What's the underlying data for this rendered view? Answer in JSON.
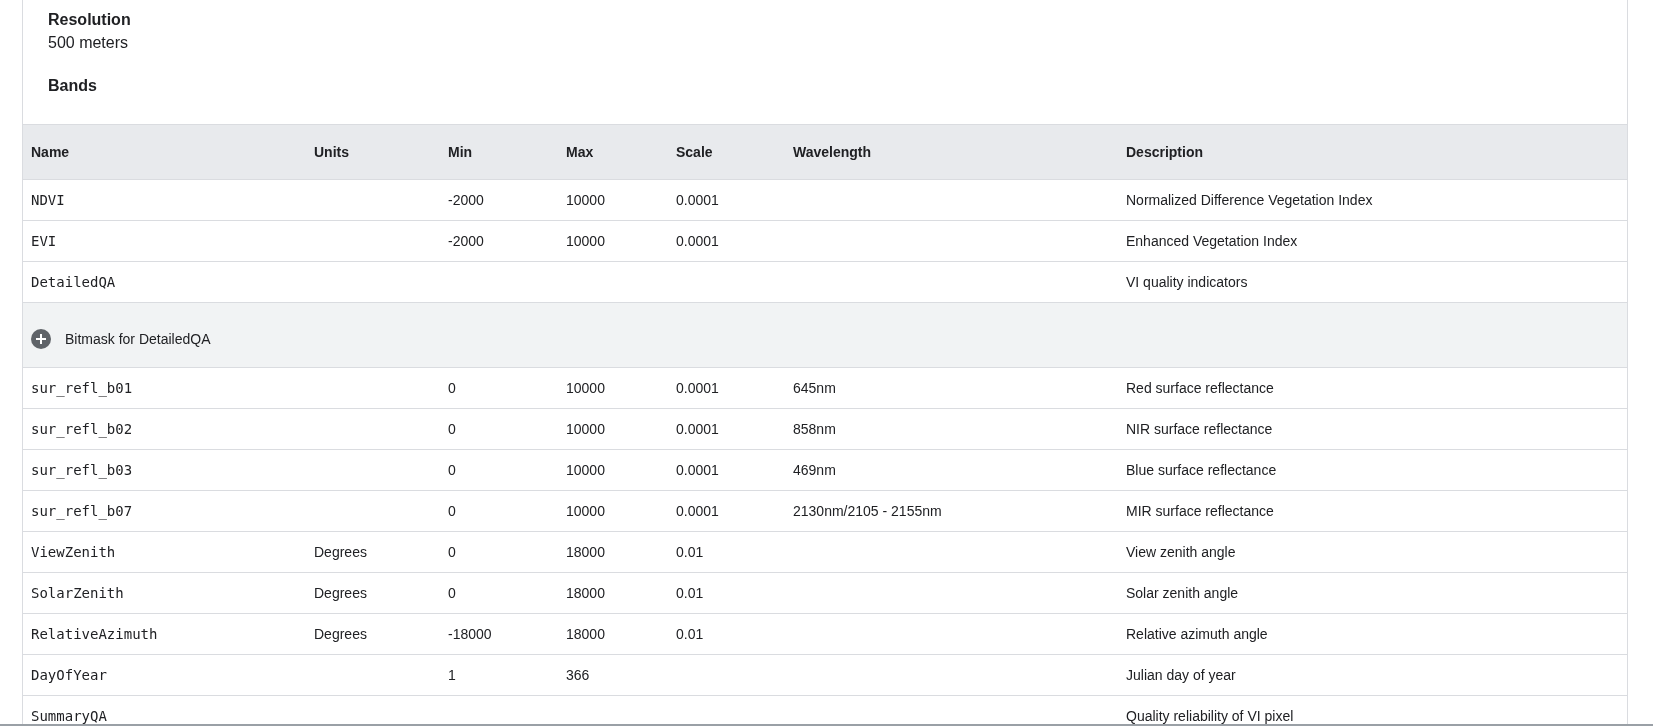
{
  "resolution": {
    "label": "Resolution",
    "value": "500 meters"
  },
  "bands_heading": "Bands",
  "table": {
    "columns": [
      "Name",
      "Units",
      "Min",
      "Max",
      "Scale",
      "Wavelength",
      "Description"
    ],
    "rows": [
      {
        "kind": "band",
        "name": "NDVI",
        "units": "",
        "min": "-2000",
        "max": "10000",
        "scale": "0.0001",
        "wavelength": "",
        "description": "Normalized Difference Vegetation Index"
      },
      {
        "kind": "band",
        "name": "EVI",
        "units": "",
        "min": "-2000",
        "max": "10000",
        "scale": "0.0001",
        "wavelength": "",
        "description": "Enhanced Vegetation Index"
      },
      {
        "kind": "band",
        "name": "DetailedQA",
        "units": "",
        "min": "",
        "max": "",
        "scale": "",
        "wavelength": "",
        "description": "VI quality indicators"
      },
      {
        "kind": "bitmask",
        "label": "Bitmask for DetailedQA",
        "expanded": false
      },
      {
        "kind": "band",
        "name": "sur_refl_b01",
        "units": "",
        "min": "0",
        "max": "10000",
        "scale": "0.0001",
        "wavelength": "645nm",
        "description": "Red surface reflectance"
      },
      {
        "kind": "band",
        "name": "sur_refl_b02",
        "units": "",
        "min": "0",
        "max": "10000",
        "scale": "0.0001",
        "wavelength": "858nm",
        "description": "NIR surface reflectance"
      },
      {
        "kind": "band",
        "name": "sur_refl_b03",
        "units": "",
        "min": "0",
        "max": "10000",
        "scale": "0.0001",
        "wavelength": "469nm",
        "description": "Blue surface reflectance"
      },
      {
        "kind": "band",
        "name": "sur_refl_b07",
        "units": "",
        "min": "0",
        "max": "10000",
        "scale": "0.0001",
        "wavelength": "2130nm/2105 - 2155nm",
        "description": "MIR surface reflectance"
      },
      {
        "kind": "band",
        "name": "ViewZenith",
        "units": "Degrees",
        "min": "0",
        "max": "18000",
        "scale": "0.01",
        "wavelength": "",
        "description": "View zenith angle"
      },
      {
        "kind": "band",
        "name": "SolarZenith",
        "units": "Degrees",
        "min": "0",
        "max": "18000",
        "scale": "0.01",
        "wavelength": "",
        "description": "Solar zenith angle"
      },
      {
        "kind": "band",
        "name": "RelativeAzimuth",
        "units": "Degrees",
        "min": "-18000",
        "max": "18000",
        "scale": "0.01",
        "wavelength": "",
        "description": "Relative azimuth angle"
      },
      {
        "kind": "band",
        "name": "DayOfYear",
        "units": "",
        "min": "1",
        "max": "366",
        "scale": "",
        "wavelength": "",
        "description": "Julian day of year"
      },
      {
        "kind": "band",
        "name": "SummaryQA",
        "units": "",
        "min": "",
        "max": "",
        "scale": "",
        "wavelength": "",
        "description": "Quality reliability of VI pixel"
      }
    ]
  }
}
